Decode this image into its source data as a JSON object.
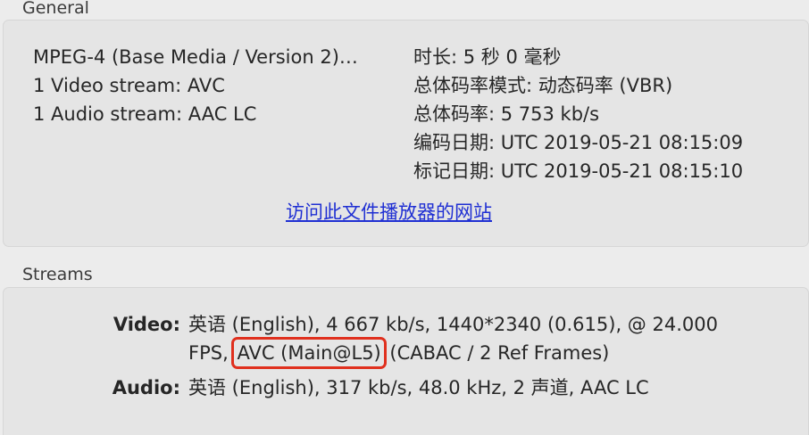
{
  "general": {
    "section_title": "General",
    "left_lines": [
      "MPEG-4 (Base Media / Version 2)…",
      "1 Video stream: AVC",
      "1 Audio stream: AAC LC"
    ],
    "right_lines": [
      "时长: 5 秒 0 毫秒",
      "总体码率模式: 动态码率 (VBR)",
      "总体码率: 5 753 kb/s",
      "编码日期: UTC 2019-05-21 08:15:09",
      "标记日期: UTC 2019-05-21 08:15:10"
    ],
    "website_link": "访问此文件播放器的网站"
  },
  "streams": {
    "section_title": "Streams",
    "video": {
      "label": "Video:",
      "line1": "英语 (English), 4 667 kb/s, 1440*2340 (0.615), @ 24.000",
      "line2_prefix": "FPS, ",
      "line2_highlight": "AVC (Main@L5)",
      "line2_suffix": " (CABAC / 2 Ref Frames)"
    },
    "audio": {
      "label": "Audio:",
      "line1": "英语 (English), 317 kb/s, 48.0 kHz, 2 声道, AAC LC"
    },
    "highlight_color": "#e0301e"
  }
}
